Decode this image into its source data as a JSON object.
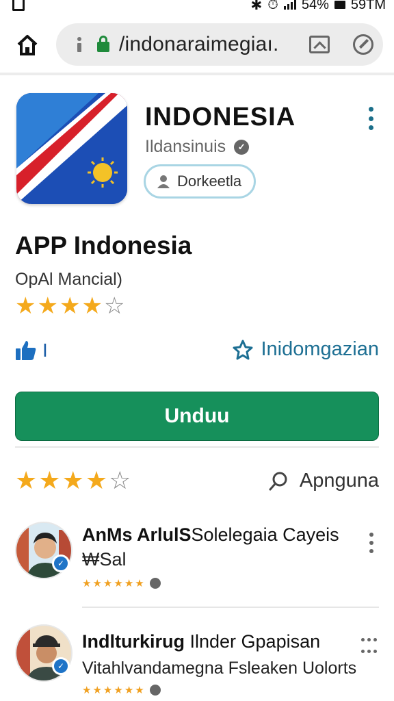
{
  "status_bar": {
    "battery": "54%",
    "time": "59TM",
    "icons": [
      "notification-icon",
      "bluetooth-icon",
      "alarm-icon",
      "signal-icon",
      "battery-icon"
    ]
  },
  "browser": {
    "url": "/indonaraimegiaı.",
    "icons": [
      "home-icon",
      "info-icon",
      "lock-icon",
      "tabs-icon",
      "compass-icon"
    ]
  },
  "app": {
    "title": "INDONESIA",
    "developer": "Ildansinuis",
    "chip_label": "Dorkeetla",
    "name": "APP Indonesia",
    "subtitle": "OрAl Mancial)",
    "rating": 4,
    "rating_max": 5,
    "likes": "I",
    "info_link": "Inidomgazian",
    "install_label": "Unduu"
  },
  "reviews_section": {
    "rating": 4,
    "rating_max": 5,
    "search_label": "Apnguna"
  },
  "reviews": [
    {
      "name_bold": "AnMs ArlulS",
      "name_rest": "Solelegaia Cayeis",
      "line2": "₩Sal",
      "stars": 6
    },
    {
      "name_bold": "Indlturkirug",
      "name_rest": " Ilnder Gpapisan",
      "line2": "Vitahlvandamegna Fsleaken Uolorts",
      "stars": 6
    }
  ],
  "colors": {
    "install_green": "#16905b",
    "star_gold": "#f4a91c",
    "link_blue": "#1d6f93",
    "chip_border": "#a9d5e4"
  }
}
